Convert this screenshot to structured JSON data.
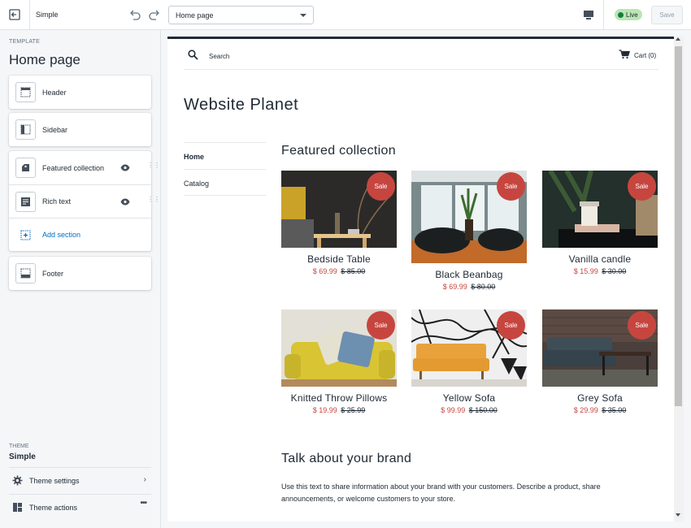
{
  "topbar": {
    "theme_name": "Simple",
    "page_select": "Home page",
    "live_label": "Live",
    "save_label": "Save"
  },
  "sidebar": {
    "eyebrow": "TEMPLATE",
    "title": "Home page",
    "sections": [
      {
        "label": "Header",
        "icon": "header-layout-icon"
      },
      {
        "label": "Sidebar",
        "icon": "sidebar-layout-icon"
      },
      {
        "label": "Featured collection",
        "icon": "collection-icon"
      },
      {
        "label": "Rich text",
        "icon": "text-block-icon"
      },
      {
        "label": "Add section",
        "icon": "add-section-icon"
      },
      {
        "label": "Footer",
        "icon": "footer-layout-icon"
      }
    ],
    "theme_label": "THEME",
    "theme_name": "Simple",
    "theme_settings": "Theme settings",
    "theme_actions": "Theme actions"
  },
  "preview": {
    "search_label": "Search",
    "cart_label": "Cart (0)",
    "store_name": "Website Planet",
    "nav": [
      "Home",
      "Catalog"
    ],
    "featured_title": "Featured collection",
    "sale_label": "Sale",
    "products": [
      {
        "name": "Bedside Table",
        "price": "$ 69.99",
        "compare": "$ 85.00"
      },
      {
        "name": "Black Beanbag",
        "price": "$ 69.99",
        "compare": "$ 80.00"
      },
      {
        "name": "Vanilla candle",
        "price": "$ 15.99",
        "compare": "$ 30.00"
      },
      {
        "name": "Knitted Throw Pillows",
        "price": "$ 19.99",
        "compare": "$ 25.99"
      },
      {
        "name": "Yellow Sofa",
        "price": "$ 99.99",
        "compare": "$ 150.00"
      },
      {
        "name": "Grey Sofa",
        "price": "$ 29.99",
        "compare": "$ 35.00"
      }
    ],
    "brand_title": "Talk about your brand",
    "brand_text": "Use this text to share information about your brand with your customers. Describe a product, share announcements, or welcome customers to your store."
  },
  "colors": {
    "accent_link": "#006fbb",
    "sale_red": "#c6463f",
    "live_green": "#108043"
  }
}
